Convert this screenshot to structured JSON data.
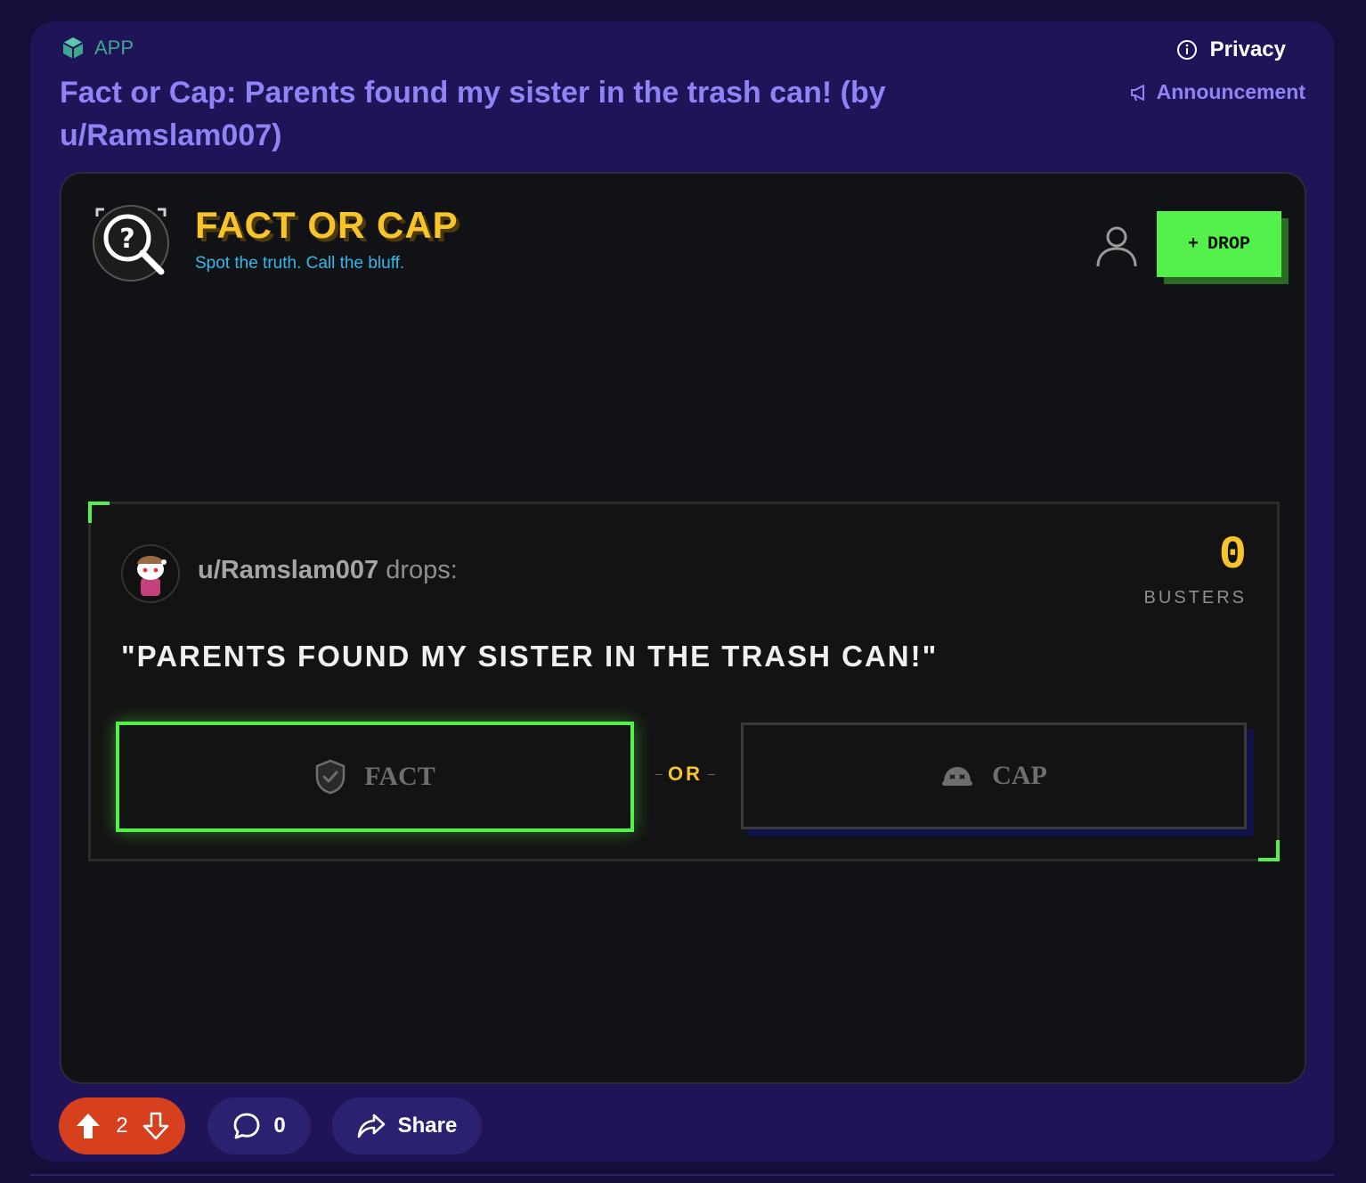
{
  "post": {
    "app_label": "APP",
    "privacy_label": "Privacy",
    "announcement_label": "Announcement",
    "title": "Fact or Cap: Parents found my sister in the trash can! (by u/Ramslam007)"
  },
  "app": {
    "brand_title": "FACT OR CAP",
    "brand_subtitle": "Spot the truth. Call the bluff.",
    "drop_label": "DROP",
    "drop_plus": "+",
    "card": {
      "username": "u/Ramslam007",
      "drops_label": "drops:",
      "busters_count": "0",
      "busters_label": "BUSTERS",
      "statement": "\"PARENTS FOUND MY SISTER IN THE TRASH CAN!\"",
      "fact_label": "FACT",
      "or_label": "OR",
      "cap_label": "CAP"
    }
  },
  "actions": {
    "vote_count": "2",
    "comment_count": "0",
    "share_label": "Share"
  },
  "colors": {
    "accent_green": "#54f04b",
    "brand_yellow": "#f7c42c",
    "subtitle_blue": "#32b9ec",
    "post_bg": "#1f1458",
    "upvote_orange": "#d6401f"
  },
  "icons": [
    "app-cube-icon",
    "info-icon",
    "megaphone-icon",
    "magnifier-question-icon",
    "user-icon",
    "shield-check-icon",
    "cap-icon",
    "upvote-icon",
    "downvote-icon",
    "comment-icon",
    "share-icon"
  ]
}
